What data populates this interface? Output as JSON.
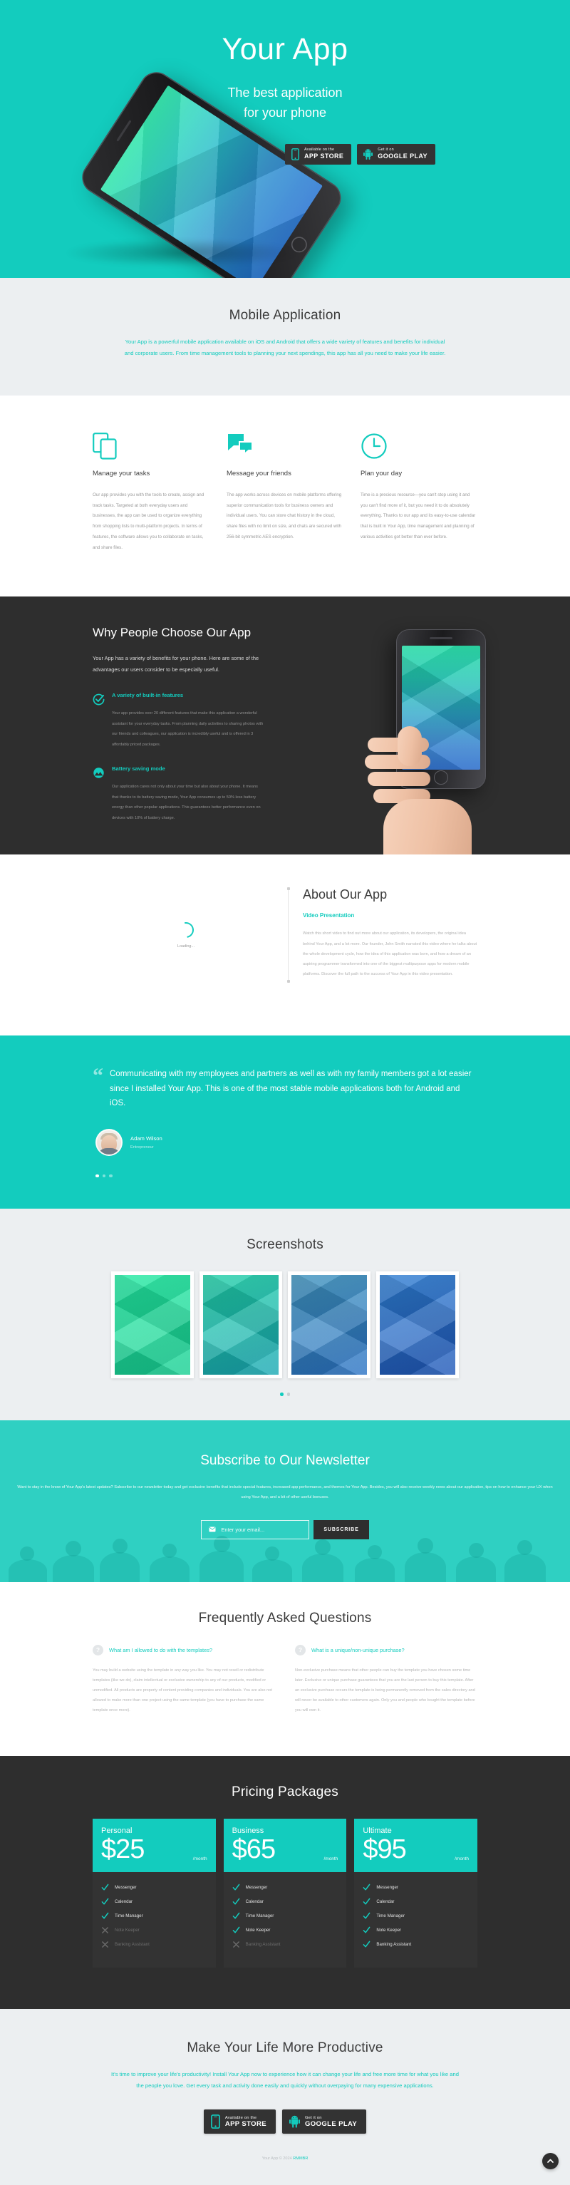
{
  "brand": {
    "accent": "#13ccbe",
    "dark": "#2e2e2e",
    "light": "#eceff1"
  },
  "hero": {
    "title": "Your App",
    "subtitle_line1": "The best application",
    "subtitle_line2": "for your phone",
    "badges": [
      {
        "small": "Available on the",
        "big": "APP STORE",
        "icon": "apple-phone-icon"
      },
      {
        "small": "Get it on",
        "big": "GOOGLE PLAY",
        "icon": "android-robot-icon"
      }
    ]
  },
  "mobile_app": {
    "title": "Mobile Application",
    "lead": "Your App is a powerful mobile application available on iOS and Android that offers a wide variety of features and benefits for individual and corporate users. From time management tools to planning your next spendings, this app has all you need to make your life easier."
  },
  "features": [
    {
      "icon": "copy-devices-icon",
      "title": "Manage your tasks",
      "text": "Our app provides you with the tools to create, assign and track tasks. Targeted at both everyday users and businesses, the app can be used to organize everything from shopping lists to multi-platform projects. In terms of features, the software allows you to collaborate on tasks, and share files."
    },
    {
      "icon": "chat-bubbles-icon",
      "title": "Message your friends",
      "text": "The app works across devices on mobile platforms offering superior communication tools for business owners and individual users. You can store chat history in the cloud, share files with no limit on size, and chats are secured with 256-bit symmetric AES encryption."
    },
    {
      "icon": "clock-icon",
      "title": "Plan your day",
      "text": "Time is a precious resource—you can't stop using it and you can't find more of it, but you need it to do absolutely everything. Thanks to our app and its easy-to-use calendar that is built in Your App, time management and planning of various activities got better than ever before."
    }
  ],
  "why": {
    "title": "Why People Choose Our App",
    "intro": "Your App has a variety of benefits for your phone. Here are some of the advantages our users consider to be especially useful.",
    "items": [
      {
        "icon": "check-circle-icon",
        "title": "A variety of built-in features",
        "text": "Your app provides over 20 different features that make this application a wonderful assistant for your everyday tasks. From planning daily activities to sharing photos with our friends and colleagues, our application is incredibly useful and is offered in 3 affordably priced packages."
      },
      {
        "icon": "battery-mountain-icon",
        "title": "Battery saving mode",
        "text": "Our application cares not only about your time but also about your phone. It means that thanks to its battery saving mode, Your App consumes up to 50% less battery energy than other popular applications. This guarantees better performance even on devices with 10% of battery charge."
      }
    ]
  },
  "about": {
    "loading_label": "Loading...",
    "title": "About Our App",
    "subtitle": "Video Presentation",
    "text": "Watch this short video to find out more about our application, its developers, the original idea behind Your App, and a lot more. Our founder, John Smith narrated this video where he talks about the whole development cycle, how the idea of this application was born, and how a dream of an aspiring programmer transformed into one of the biggest multipurpose apps for modern mobile platforms. Discover the full path to the success of Your App in this video presentation."
  },
  "testimonial": {
    "quote": "Communicating with my employees and partners as well as with my family members got a lot easier since I installed Your App. This is one of the most stable mobile applications both for Android and iOS.",
    "author": "Adam Wilson",
    "role": "Entrepreneur",
    "slides": 3,
    "active_slide": 1
  },
  "screenshots": {
    "title": "Screenshots",
    "items": [
      "screenshot-1",
      "screenshot-2",
      "screenshot-3",
      "screenshot-4"
    ],
    "slides": 2,
    "active_slide": 1
  },
  "newsletter": {
    "title": "Subscribe to Our Newsletter",
    "text": "Want to stay in the know of Your App's latest updates? Subscribe to our newsletter today and get exclusive benefits that include special features, increased app performance, and themes for Your App. Besides, you will also receive weekly news about our application, tips on how to enhance your UX when using Your App, and a bit of other useful bonuses.",
    "email_placeholder": "Enter your email...",
    "email_value": "",
    "submit_label": "SUBSCRIBE"
  },
  "faq": {
    "title": "Frequently Asked Questions",
    "items": [
      {
        "question": "What am I allowed to do with the templates?",
        "answer": "You may build a website using the template in any way you like. You may not resell or redistribute templates (like we do), claim intellectual or exclusive ownership to any of our products, modified or unmodified. All products are property of content providing companies and individuals. You are also not allowed to make more than one project using the same template (you have to purchase the same template once more)."
      },
      {
        "question": "What is a unique/non-unique purchase?",
        "answer": "Non-exclusive purchase means that other people can buy the template you have chosen some time later. Exclusive or unique purchase guarantees that you are the last person to buy this template. After an exclusive purchase occurs the template is being permanently removed from the sales directory and will never be available to other customers again. Only you and people who bought the template before you will own it."
      }
    ]
  },
  "pricing": {
    "title": "Pricing Packages",
    "period": "/month",
    "plans": [
      {
        "name": "Personal",
        "price": "$25",
        "features": [
          {
            "label": "Messenger",
            "included": true
          },
          {
            "label": "Calendar",
            "included": true
          },
          {
            "label": "Time Manager",
            "included": true
          },
          {
            "label": "Note Keeper",
            "included": false
          },
          {
            "label": "Banking Assistant",
            "included": false
          }
        ]
      },
      {
        "name": "Business",
        "price": "$65",
        "features": [
          {
            "label": "Messenger",
            "included": true
          },
          {
            "label": "Calendar",
            "included": true
          },
          {
            "label": "Time Manager",
            "included": true
          },
          {
            "label": "Note Keeper",
            "included": true
          },
          {
            "label": "Banking Assistant",
            "included": false
          }
        ]
      },
      {
        "name": "Ultimate",
        "price": "$95",
        "features": [
          {
            "label": "Messenger",
            "included": true
          },
          {
            "label": "Calendar",
            "included": true
          },
          {
            "label": "Time Manager",
            "included": true
          },
          {
            "label": "Note Keeper",
            "included": true
          },
          {
            "label": "Banking Assistant",
            "included": true
          }
        ]
      }
    ]
  },
  "cta": {
    "title": "Make Your Life More Productive",
    "text": "It's time to improve your life's productivity! Install Your App now to experience how it can change your life and free more time for what you like and the people you love. Get every task and activity done easily and quickly without overpaying for many expensive applications.",
    "badges": [
      {
        "small": "Available on the",
        "big": "APP STORE",
        "icon": "apple-phone-icon"
      },
      {
        "small": "Get it on",
        "big": "GOOGLE PLAY",
        "icon": "android-robot-icon"
      }
    ]
  },
  "footer": {
    "copyright_prefix": "Your App © 2024 ",
    "copyright_link": "RMMBR",
    "back_to_top_icon": "chevron-up-icon"
  }
}
